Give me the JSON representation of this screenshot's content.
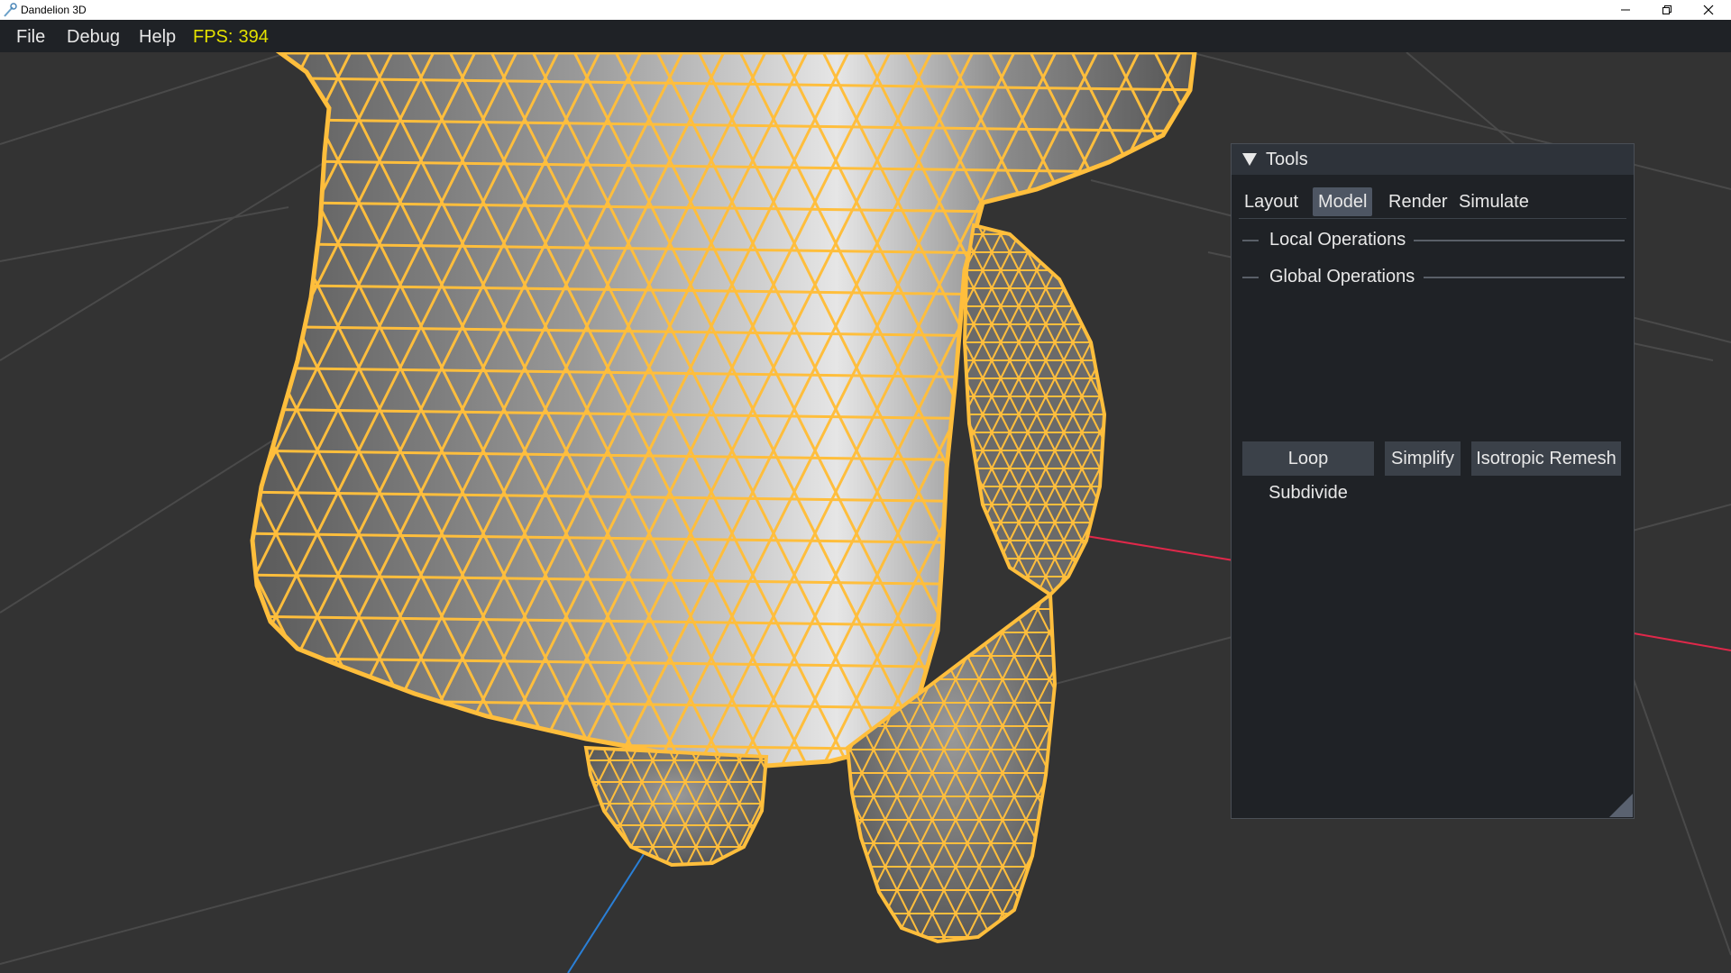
{
  "window": {
    "title": "Dandelion 3D",
    "app_icon": "dandelion-icon",
    "controls": [
      "minimize-icon",
      "restore-icon",
      "close-icon"
    ]
  },
  "menubar": {
    "items": [
      {
        "label": "File"
      },
      {
        "label": "Debug"
      },
      {
        "label": "Help"
      }
    ],
    "fps_label": "FPS:",
    "fps_value": "394"
  },
  "viewport": {
    "background": "#333333",
    "grid_color": "#4a4a4a",
    "wireframe_color": "#ffbe3c",
    "x_axis_color": "#e0284a",
    "z_axis_color": "#2a7fd6"
  },
  "tools_panel": {
    "title": "Tools",
    "tabs": [
      {
        "label": "Layout",
        "active": false
      },
      {
        "label": "Model",
        "active": true
      },
      {
        "label": "Render",
        "active": false
      },
      {
        "label": "Simulate",
        "active": false
      }
    ],
    "sections": [
      {
        "label": "Local Operations"
      },
      {
        "label": "Global Operations"
      }
    ],
    "buttons": [
      {
        "label": "Loop Subdivide"
      },
      {
        "label": "Simplify"
      },
      {
        "label": "Isotropic Remesh"
      }
    ]
  }
}
